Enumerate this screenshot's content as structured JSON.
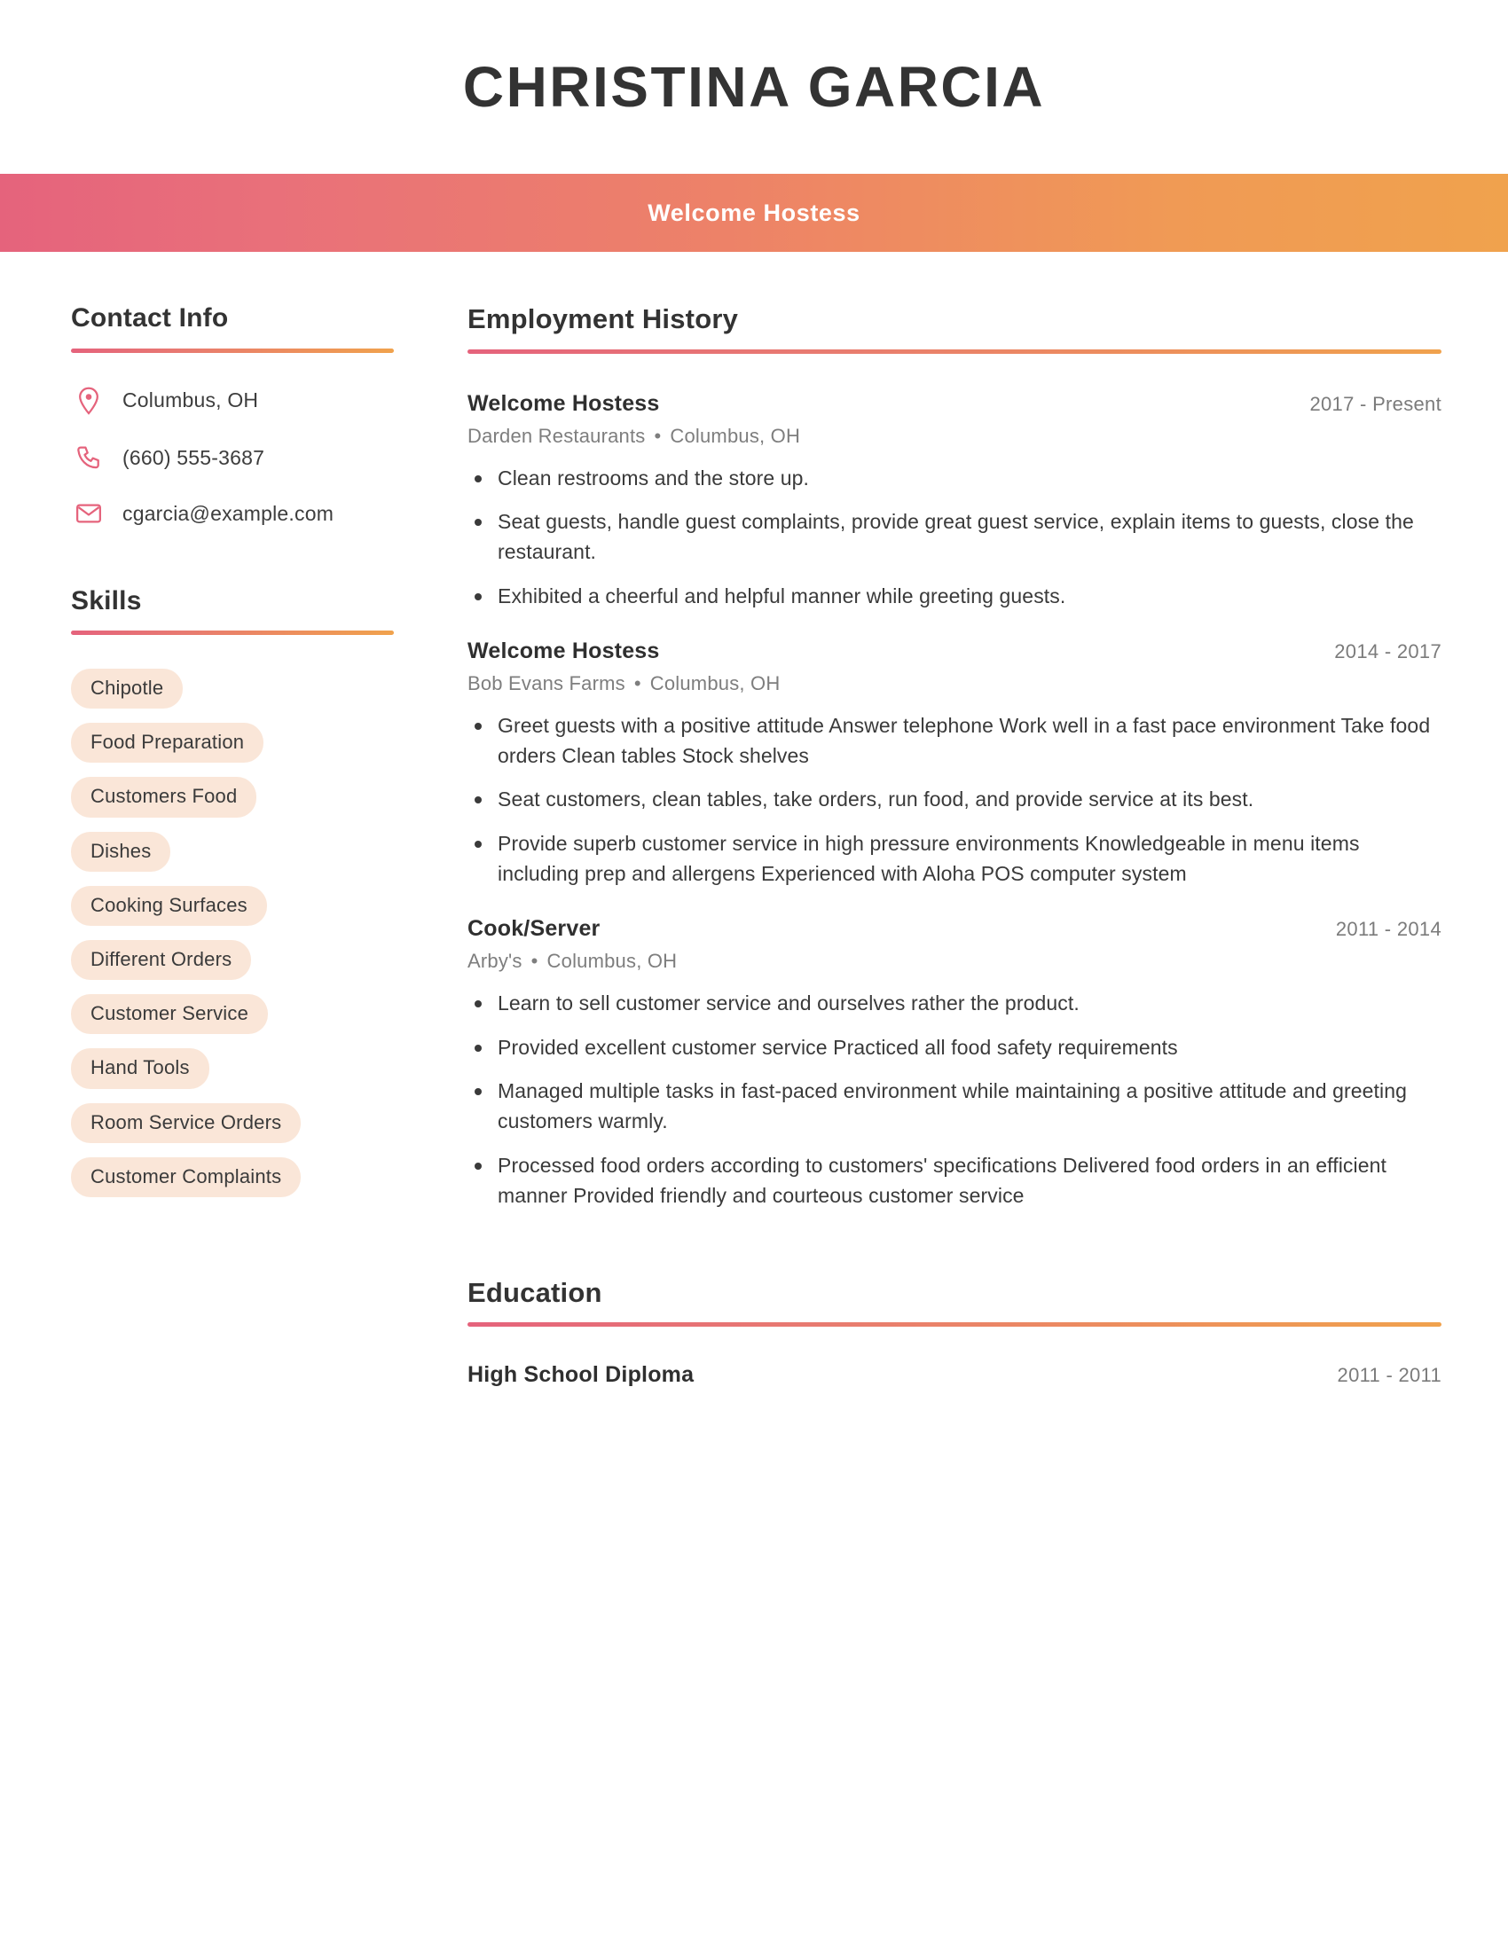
{
  "header": {
    "name": "CHRISTINA GARCIA",
    "job_title_banner": "Welcome Hostess"
  },
  "colors": {
    "gradient_start": "#e5637c",
    "gradient_end": "#f0a24d",
    "skill_pill_bg": "#fae6d8",
    "heading_text": "#333333",
    "muted_text": "#7b7b7b"
  },
  "sidebar": {
    "contact": {
      "heading": "Contact Info",
      "items": [
        {
          "icon": "location-pin-icon",
          "value": "Columbus, OH"
        },
        {
          "icon": "phone-icon",
          "value": "(660) 555-3687"
        },
        {
          "icon": "envelope-icon",
          "value": "cgarcia@example.com"
        }
      ]
    },
    "skills": {
      "heading": "Skills",
      "items": [
        "Chipotle",
        "Food Preparation",
        "Customers Food",
        "Dishes",
        "Cooking Surfaces",
        "Different Orders",
        "Customer Service",
        "Hand Tools",
        "Room Service Orders",
        "Customer Complaints"
      ]
    }
  },
  "main": {
    "employment": {
      "heading": "Employment History",
      "jobs": [
        {
          "title": "Welcome Hostess",
          "dates": "2017 - Present",
          "company": "Darden Restaurants",
          "separator": "•",
          "location": "Columbus, OH",
          "bullets": [
            "Clean restrooms and the store up.",
            "Seat guests, handle guest complaints, provide great guest service, explain items to guests, close the restaurant.",
            "Exhibited a cheerful and helpful manner while greeting guests."
          ]
        },
        {
          "title": "Welcome Hostess",
          "dates": "2014 - 2017",
          "company": "Bob Evans Farms",
          "separator": "•",
          "location": "Columbus, OH",
          "bullets": [
            "Greet guests with a positive attitude Answer telephone Work well in a fast pace environment Take food orders Clean tables Stock shelves",
            "Seat customers, clean tables, take orders, run food, and provide service at its best.",
            "Provide superb customer service in high pressure environments Knowledgeable in menu items including prep and allergens Experienced with Aloha POS computer system"
          ]
        },
        {
          "title": "Cook/Server",
          "dates": "2011 - 2014",
          "company": "Arby's",
          "separator": "•",
          "location": "Columbus, OH",
          "bullets": [
            "Learn to sell customer service and ourselves rather the product.",
            "Provided excellent customer service Practiced all food safety requirements",
            "Managed multiple tasks in fast-paced environment while maintaining a positive attitude and greeting customers warmly.",
            "Processed food orders according to customers' specifications Delivered food orders in an efficient manner Provided friendly and courteous customer service"
          ]
        }
      ]
    },
    "education": {
      "heading": "Education",
      "entries": [
        {
          "degree": "High School Diploma",
          "dates": "2011 - 2011"
        }
      ]
    }
  }
}
